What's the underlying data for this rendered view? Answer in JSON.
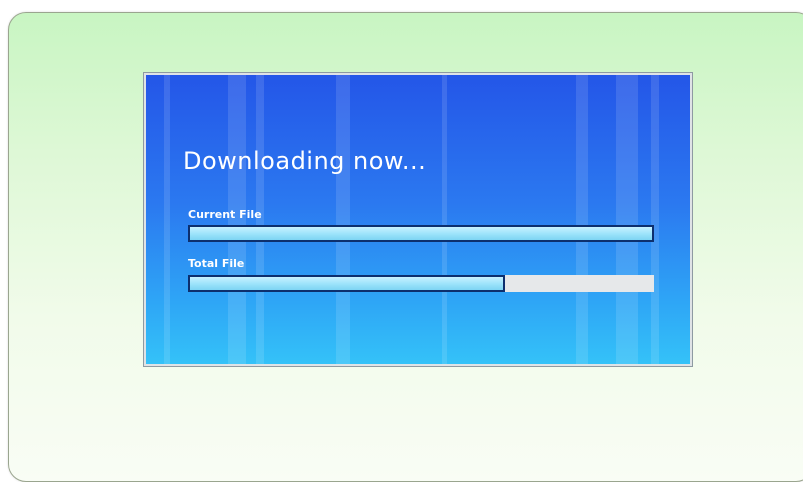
{
  "download": {
    "title": "Downloading now...",
    "current_file": {
      "label": "Current File",
      "progress": 1.0
    },
    "total_file": {
      "label": "Total File",
      "progress": 0.68
    }
  },
  "colors": {
    "panel_top": "#2456e8",
    "panel_bottom": "#34c2f8",
    "bar_fill": "#9fe4fb",
    "bar_track": "#e6e8ea",
    "card_background": "#d9f7d2"
  }
}
